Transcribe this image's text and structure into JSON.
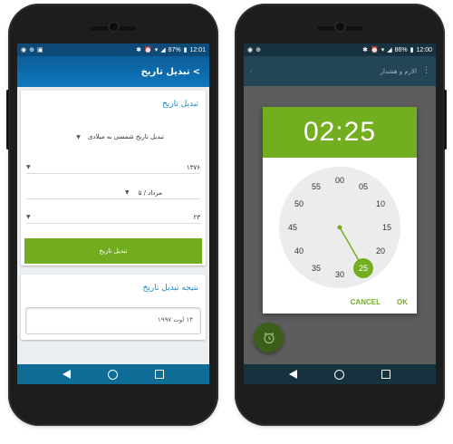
{
  "left_phone": {
    "status": {
      "battery": "87%",
      "time": "12:01"
    },
    "appbar": {
      "title": "تبدیل تاریخ",
      "back": "<"
    },
    "converter": {
      "title": "تبدیل تاریخ",
      "mode_select": "تبدیل تاریخ شمسی به میلادی",
      "year": "۱۳۷۶",
      "month": "مرداد / ۵",
      "day": "۲۳",
      "button_label": "تبدیل تاریخ"
    },
    "result": {
      "title": "نتیجه تبدیل تاریخ",
      "value": "۱۴ اوت ۱۹۹۷"
    }
  },
  "right_phone": {
    "status": {
      "battery": "86%",
      "time": "12:00"
    },
    "appbar": {
      "title": "الارم و هشدار"
    },
    "time_picker": {
      "time": "02:25",
      "selected_minute": 25,
      "dial_numbers": [
        "00",
        "05",
        "10",
        "15",
        "20",
        "25",
        "30",
        "35",
        "40",
        "45",
        "50",
        "55"
      ],
      "cancel_label": "CANCEL",
      "ok_label": "OK"
    }
  },
  "colors": {
    "accent_green": "#74ac1f",
    "app_blue": "#0f77bd",
    "title_blue": "#1a8dc4",
    "dark_teal": "#17323f"
  },
  "icons": {
    "fab": "alarm-clock-icon"
  }
}
